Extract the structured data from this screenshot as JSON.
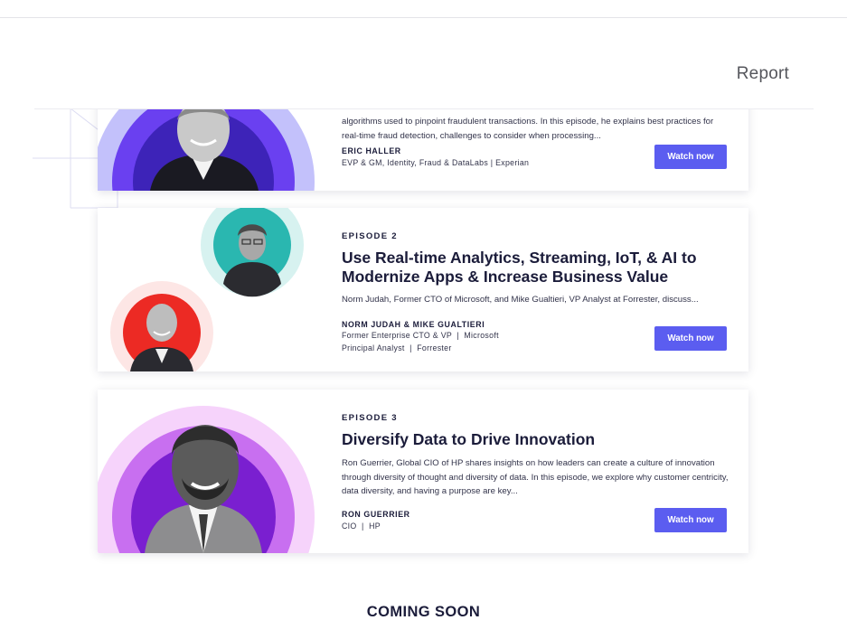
{
  "header": {
    "report_label": "Report"
  },
  "episodes": [
    {
      "description": "algorithms used to pinpoint fraudulent transactions. In this episode, he explains best practices for real-time fraud detection, challenges to consider when processing...",
      "speaker": "ERIC HALLER",
      "roles": [
        "EVP & GM, Identity, Fraud & DataLabs | Experian"
      ],
      "button_label": "Watch now",
      "ring_colors": [
        "#c3c1fb",
        "#6a40f0",
        "#3d23b8"
      ]
    },
    {
      "label": "EPISODE 2",
      "title": "Use Real-time Analytics, Streaming, IoT, & AI to Modernize Apps & Increase Business Value",
      "description": "Norm Judah, Former CTO of Microsoft, and Mike Gualtieri, VP Analyst at Forrester, discuss...",
      "speaker": "NORM JUDAH & MIKE GUALTIERI",
      "roles": [
        "Former Enterprise CTO & VP  |  Microsoft",
        "Principal Analyst  |  Forrester"
      ],
      "button_label": "Watch now",
      "ring_colors": [
        "#d7f2f0",
        "#2ab7b0",
        "#fde6e5",
        "#ec2a24"
      ]
    },
    {
      "label": "EPISODE 3",
      "title": "Diversify Data to Drive Innovation",
      "description": "Ron Guerrier, Global CIO of HP shares insights on how leaders can create a culture of innovation through diversity of thought and diversity of data. In this episode, we explore why customer centricity, data diversity, and having a purpose are key...",
      "speaker": "RON GUERRIER",
      "roles": [
        "CIO  |  HP"
      ],
      "button_label": "Watch now",
      "ring_colors": [
        "#f6d3fb",
        "#c86ff0",
        "#7a1fd0"
      ]
    }
  ],
  "footer": {
    "coming_soon": "COMING SOON"
  },
  "colors": {
    "button": "#5b5df0",
    "text": "#1b1c3a"
  }
}
